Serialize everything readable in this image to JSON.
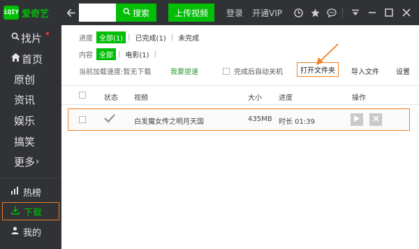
{
  "app": {
    "logo_mark": "iQIY",
    "logo_text": "爱奇艺"
  },
  "sidebar": {
    "nav": [
      {
        "label": "找片",
        "icon": "search-icon"
      },
      {
        "label": "首页",
        "icon": "home-icon"
      },
      {
        "label": "原创"
      },
      {
        "label": "资讯"
      },
      {
        "label": "娱乐"
      },
      {
        "label": "搞笑"
      },
      {
        "label": "更多",
        "suffix": "›"
      }
    ],
    "sub": [
      {
        "label": "热榜",
        "icon": "bar-chart-icon"
      },
      {
        "label": "下载",
        "icon": "download-icon",
        "active": true
      },
      {
        "label": "我的",
        "icon": "user-icon"
      }
    ]
  },
  "topbar": {
    "search_placeholder": "",
    "search_label": "搜索",
    "upload_label": "上传视频",
    "login_label": "登录",
    "vip_label": "开通VIP"
  },
  "filters": {
    "progress": {
      "label": "进度",
      "options": [
        "全部(1)",
        "已完成(1)",
        "未完成"
      ]
    },
    "content": {
      "label": "内容",
      "options": [
        "全部",
        "电影(1)"
      ]
    }
  },
  "actions": {
    "speed_text": "当前加载速度:暂无下载",
    "speedup_label": "我要提速",
    "auto_shutdown_label": "完成后自动关机",
    "open_folder_label": "打开文件夹",
    "import_label": "导入文件",
    "settings_label": "设置"
  },
  "table": {
    "headers": {
      "status": "状态",
      "video": "视频",
      "size": "大小",
      "progress": "进度",
      "ops": "操作"
    },
    "rows": [
      {
        "title": "白发魔女传之明月天国",
        "size": "435MB",
        "progress": "时长 01:39"
      }
    ]
  },
  "colors": {
    "brand": "#00be06",
    "highlight": "#f07f23",
    "sidebar_bg": "#303236"
  }
}
